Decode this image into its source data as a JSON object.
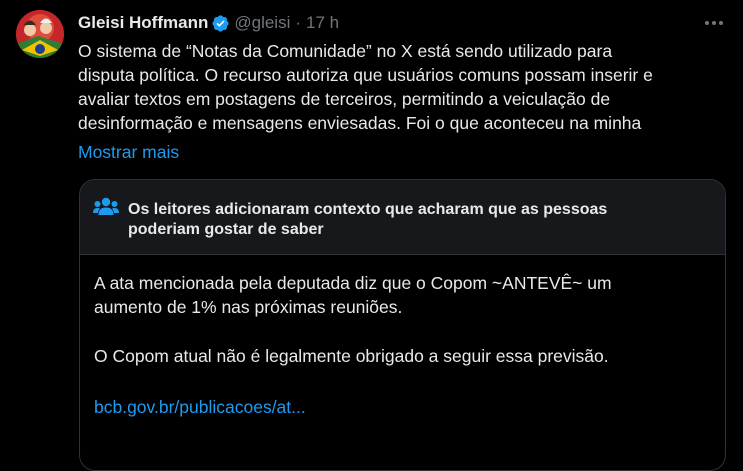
{
  "tweet": {
    "author_name": "Gleisi Hoffmann",
    "handle": "@gleisi",
    "separator": "·",
    "time": "17 h",
    "text_lines": [
      "O sistema de “Notas da Comunidade” no X está sendo utilizado para",
      "disputa política. O recurso autoriza que usuários comuns possam inserir e",
      "avaliar textos em postagens de terceiros, permitindo a veiculação de",
      "desinformação e mensagens enviesadas. Foi o que aconteceu na minha"
    ],
    "show_more": "Mostrar mais"
  },
  "note": {
    "title_line1": "Os leitores adicionaram contexto que acharam que as pessoas",
    "title_line2": "poderiam gostar de saber",
    "para1_line1": "A ata mencionada pela deputada diz que o Copom ~ANTEVÊ~ um",
    "para1_line2": "aumento de 1% nas próximas reuniões.",
    "para2": "O Copom atual não é legalmente obrigado a seguir essa previsão.",
    "link": "bcb.gov.br/publicacoes/at..."
  },
  "icons": {
    "verified": "verified-badge-icon",
    "more": "more-options-icon",
    "community": "people-icon"
  },
  "colors": {
    "accent": "#1d9bf0",
    "background": "#000000",
    "note_header_bg": "#16181c",
    "muted": "#71767b"
  }
}
